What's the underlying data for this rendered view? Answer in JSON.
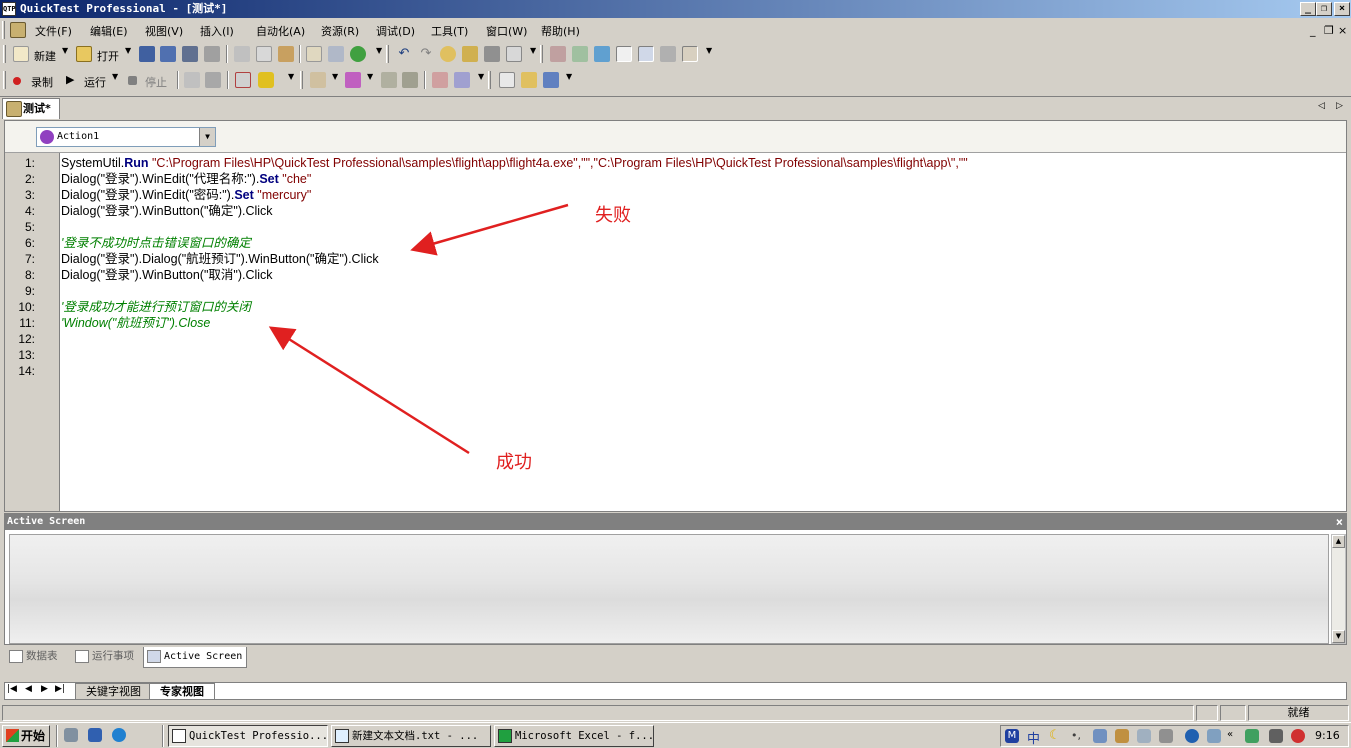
{
  "window": {
    "title": "QuickTest Professional - [测试*]",
    "app_icon_text": "QTP",
    "controls": {
      "minimize": "_",
      "restore": "❐",
      "close": "×"
    }
  },
  "menu": {
    "items": [
      "文件(F)",
      "编辑(E)",
      "视图(V)",
      "插入(I)",
      "自动化(A)",
      "资源(R)",
      "调试(D)",
      "工具(T)",
      "窗口(W)",
      "帮助(H)"
    ],
    "mdi": {
      "minimize": "_",
      "restore": "❐",
      "close": "×"
    }
  },
  "toolbar1": {
    "new_label": "新建",
    "open_label": "打开"
  },
  "toolbar2": {
    "record_label": "录制",
    "run_label": "运行",
    "stop_label": "停止"
  },
  "doc_tab": {
    "label": "测试*"
  },
  "action_selector": {
    "value": "Action1"
  },
  "editor": {
    "line_numbers": [
      "1:",
      "2:",
      "3:",
      "4:",
      "5:",
      "6:",
      "7:",
      "8:",
      "9:",
      "10:",
      "11:",
      "12:",
      "13:",
      "14:"
    ],
    "lines": {
      "l1_a": "SystemUtil.",
      "l1_kw": "Run",
      "l1_b": " \"C:\\Program Files\\HP\\QuickTest Professional\\samples\\flight\\app\\flight4a.exe\",\"\",\"C:\\Program Files\\HP\\QuickTest Professional\\samples\\flight\\app\\\",\"\"",
      "l2_a": "Dialog(\"登录\").WinEdit(\"代理名称:\").",
      "l2_kw": "Set",
      "l2_b": " \"che\"",
      "l3_a": "Dialog(\"登录\").WinEdit(\"密码:\").",
      "l3_kw": "Set",
      "l3_b": " \"mercury\"",
      "l4": "Dialog(\"登录\").WinButton(\"确定\").Click",
      "l6": "'登录不成功时点击错误窗口的确定",
      "l7": "Dialog(\"登录\").Dialog(\"航班预订\").WinButton(\"确定\").Click",
      "l8": "Dialog(\"登录\").WinButton(\"取消\").Click",
      "l10": "'登录成功才能进行预订窗口的关闭",
      "l11": "'Window(\"航班预订\").Close"
    }
  },
  "annotations": {
    "fail": "失败",
    "success": "成功",
    "color": "#e02020"
  },
  "active_screen": {
    "title": "Active Screen",
    "close": "×"
  },
  "bottom_tabs": [
    "数据表",
    "运行事项",
    "Active Screen"
  ],
  "view_tabs": {
    "nav": [
      "|◀",
      "◀",
      "▶",
      "▶|"
    ],
    "keyword": "关键字视图",
    "expert": "专家视图"
  },
  "status": {
    "ready": "就绪"
  },
  "taskbar": {
    "start": "开始",
    "tasks": [
      "QuickTest Professio...",
      "新建文本文档.txt - ...",
      "Microsoft Excel - f..."
    ],
    "clock": "9:16",
    "ime": "中"
  }
}
